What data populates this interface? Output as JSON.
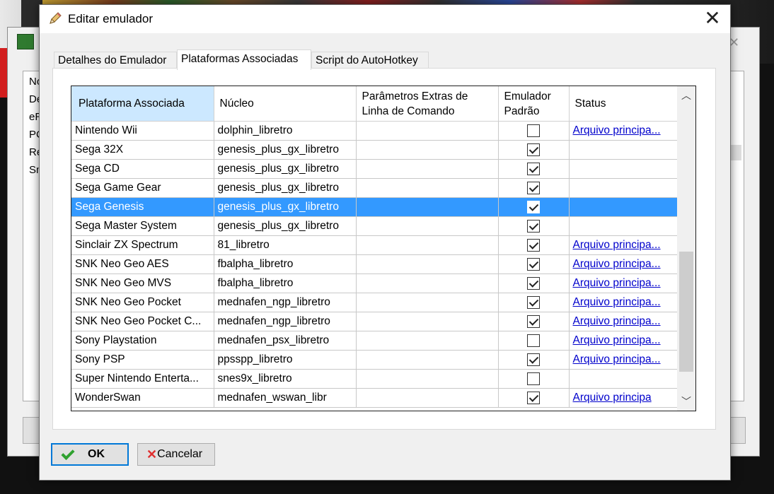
{
  "dialog": {
    "title": "Editar emulador",
    "close_glyph": "✕"
  },
  "tabs": [
    {
      "label": "Detalhes do Emulador"
    },
    {
      "label": "Plataformas Associadas",
      "active": true
    },
    {
      "label": "Script do AutoHotkey"
    }
  ],
  "grid": {
    "headers": {
      "platform": "Plataforma Associada",
      "core": "Núcleo",
      "params": "Parâmetros Extras de Linha de Comando",
      "default": "Emulador Padrão",
      "status": "Status"
    },
    "rows": [
      {
        "platform": "Nintendo Wii",
        "core": "dolphin_libretro",
        "params": "",
        "default": false,
        "status": "Arquivo principa..."
      },
      {
        "platform": "Sega 32X",
        "core": "genesis_plus_gx_libretro",
        "params": "",
        "default": true,
        "status": ""
      },
      {
        "platform": "Sega CD",
        "core": "genesis_plus_gx_libretro",
        "params": "",
        "default": true,
        "status": ""
      },
      {
        "platform": "Sega Game Gear",
        "core": "genesis_plus_gx_libretro",
        "params": "",
        "default": true,
        "status": ""
      },
      {
        "platform": "Sega Genesis",
        "core": "genesis_plus_gx_libretro",
        "params": "",
        "default": true,
        "status": "",
        "selected": true
      },
      {
        "platform": "Sega Master System",
        "core": "genesis_plus_gx_libretro",
        "params": "",
        "default": true,
        "status": ""
      },
      {
        "platform": "Sinclair ZX Spectrum",
        "core": "81_libretro",
        "params": "",
        "default": true,
        "status": "Arquivo principa..."
      },
      {
        "platform": "SNK Neo Geo AES",
        "core": "fbalpha_libretro",
        "params": "",
        "default": true,
        "status": "Arquivo principa..."
      },
      {
        "platform": "SNK Neo Geo MVS",
        "core": "fbalpha_libretro",
        "params": "",
        "default": true,
        "status": "Arquivo principa..."
      },
      {
        "platform": "SNK Neo Geo Pocket",
        "core": "mednafen_ngp_libretro",
        "params": "",
        "default": true,
        "status": "Arquivo principa..."
      },
      {
        "platform": "SNK Neo Geo Pocket C...",
        "core": "mednafen_ngp_libretro",
        "params": "",
        "default": true,
        "status": "Arquivo principa..."
      },
      {
        "platform": "Sony Playstation",
        "core": "mednafen_psx_libretro",
        "params": "",
        "default": false,
        "status": "Arquivo principa..."
      },
      {
        "platform": "Sony PSP",
        "core": "ppsspp_libretro",
        "params": "",
        "default": true,
        "status": "Arquivo principa..."
      },
      {
        "platform": "Super Nintendo Enterta...",
        "core": "snes9x_libretro",
        "params": "",
        "default": false,
        "status": ""
      },
      {
        "platform": "WonderSwan",
        "core": "mednafen_wswan_libr",
        "params": "",
        "default": true,
        "status": "Arquivo principa"
      }
    ]
  },
  "buttons": {
    "ok": "OK",
    "cancel": "Cancelar"
  },
  "background": {
    "list_items": [
      "No",
      "De",
      "eR",
      "PC",
      "Re",
      "Sn"
    ]
  },
  "colors": {
    "selection": "#3399ff",
    "header_highlight": "#cce8ff",
    "link": "#0000cc",
    "ok_border": "#0078d7"
  }
}
